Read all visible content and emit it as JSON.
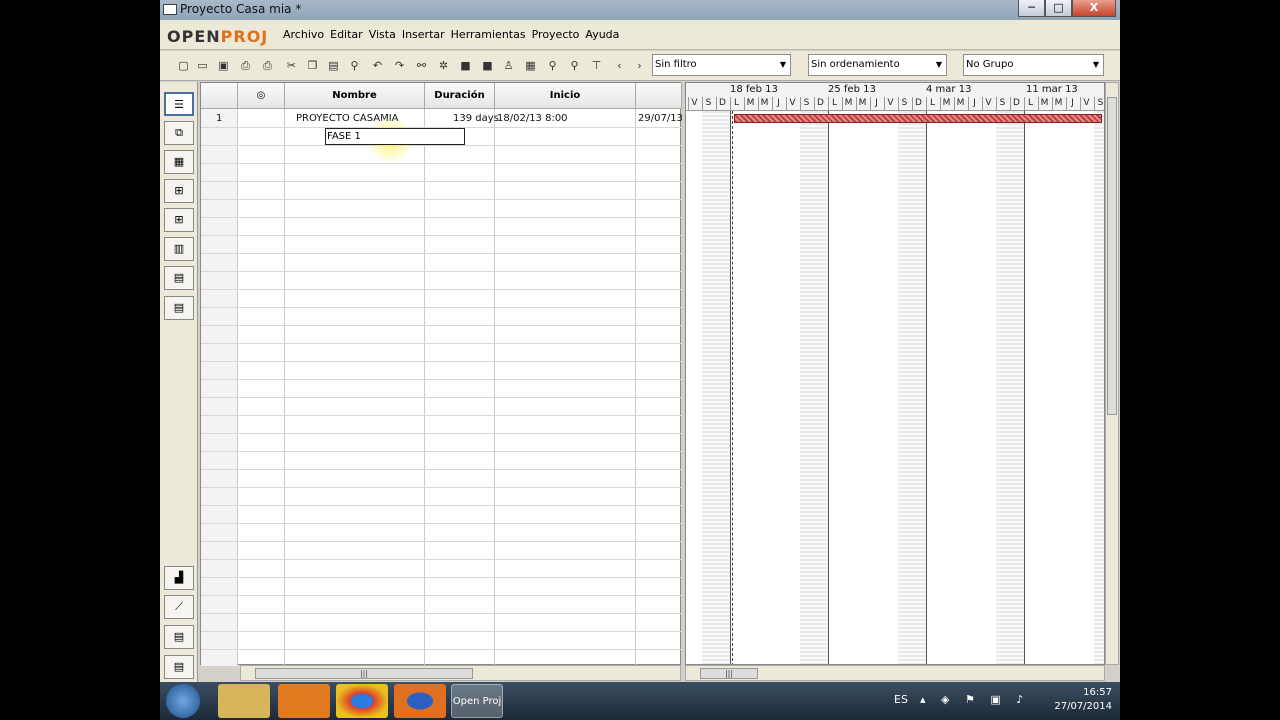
{
  "window": {
    "title": "Proyecto Casa mia *",
    "minimize": "─",
    "maximize": "□",
    "close": "X"
  },
  "logo": {
    "open": "OPEN",
    "proj": "PROJ"
  },
  "menu": [
    "Archivo",
    "Editar",
    "Vista",
    "Insertar",
    "Herramientas",
    "Proyecto",
    "Ayuda"
  ],
  "toolbar": {
    "filter": "Sin filtro",
    "sort": "Sin ordenamiento",
    "group": "No Grupo"
  },
  "table": {
    "headers": {
      "indicators": "◎",
      "name": "Nombre",
      "duration": "Duración",
      "start": "Inicio"
    },
    "rows": [
      {
        "id": "1",
        "name": "PROYECTO CASAMIA",
        "duration": "139 days",
        "start": "18/02/13 8:00",
        "finish": "29/07/13"
      }
    ],
    "editing": {
      "value": "FASE 1"
    }
  },
  "gantt": {
    "weeks": [
      "18 feb 13",
      "25 feb 13",
      "4 mar 13",
      "11 mar 13"
    ],
    "days": [
      "V",
      "S",
      "D",
      "L",
      "M",
      "M",
      "J",
      "V",
      "S",
      "D",
      "L",
      "M",
      "M",
      "J",
      "V",
      "S",
      "D",
      "L",
      "M",
      "M",
      "J",
      "V",
      "S",
      "D",
      "L",
      "M",
      "M",
      "J",
      "V",
      "S"
    ]
  },
  "taskbar": {
    "active_app": "Open Proj",
    "lang": "ES",
    "time": "16:57",
    "date": "27/07/2014"
  },
  "colors": {
    "accent": "#e0701a",
    "gantt_bar": "#c04040"
  }
}
